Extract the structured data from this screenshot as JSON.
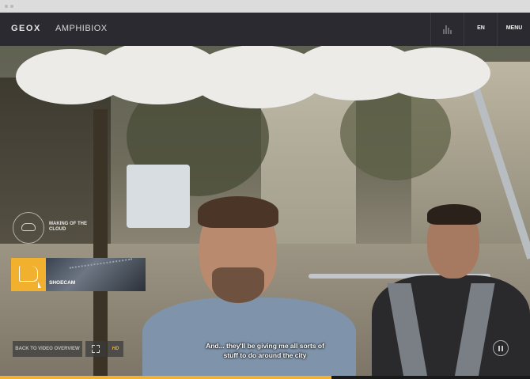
{
  "header": {
    "logo_primary": "GEOX",
    "logo_secondary": "AMPHIBIOX",
    "language": "EN",
    "menu_label": "MENU"
  },
  "sidebar": {
    "making_of_label": "MAKING OF THE CLOUD",
    "shoecam_label": "SHOECAM"
  },
  "player": {
    "back_label": "BACK TO VIDEO OVERVIEW",
    "hd_label": "HD",
    "subtitle_line1": "And... they'll be giving me all sorts of",
    "subtitle_line2": "stuff to do around the city",
    "progress_fraction": 0.625
  },
  "colors": {
    "accent": "#f1b12f",
    "nav_bg": "#2b2a30"
  },
  "icons": [
    "equalizer-icon",
    "cloud-icon",
    "shoe-icon",
    "cursor-icon",
    "fullscreen-icon",
    "pause-icon"
  ]
}
